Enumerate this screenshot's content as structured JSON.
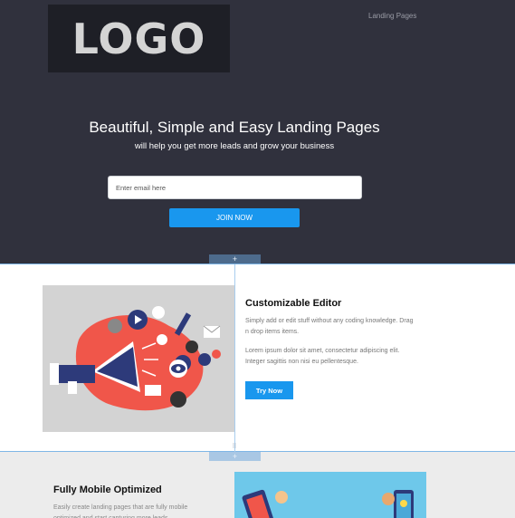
{
  "header": {
    "logo_text": "LOGO",
    "nav_link": "Landing Pages"
  },
  "hero": {
    "title": "Beautiful, Simple and Easy Landing Pages",
    "subtitle": "will help you get more leads and grow your business",
    "email_placeholder": "Enter email here",
    "join_button": "JOIN NOW"
  },
  "editor": {
    "add_symbol": "+",
    "handle_symbol": "⠿"
  },
  "section1": {
    "title": "Customizable Editor",
    "paragraph1": "Simply add or edit stuff without any coding knowledge. Drag n drop items items.",
    "paragraph2": "Lorem ipsum dolor sit amet, consectetur adipiscing elit. Integer sagittis non nisi eu pellentesque.",
    "button": "Try Now"
  },
  "section2": {
    "title": "Fully Mobile Optimized",
    "paragraph": "Easily create landing pages that are fully mobile optimized and start capturing more leads."
  },
  "colors": {
    "dark_bg": "#30313d",
    "accent_blue": "#1997ee",
    "light_section": "#ececec"
  }
}
